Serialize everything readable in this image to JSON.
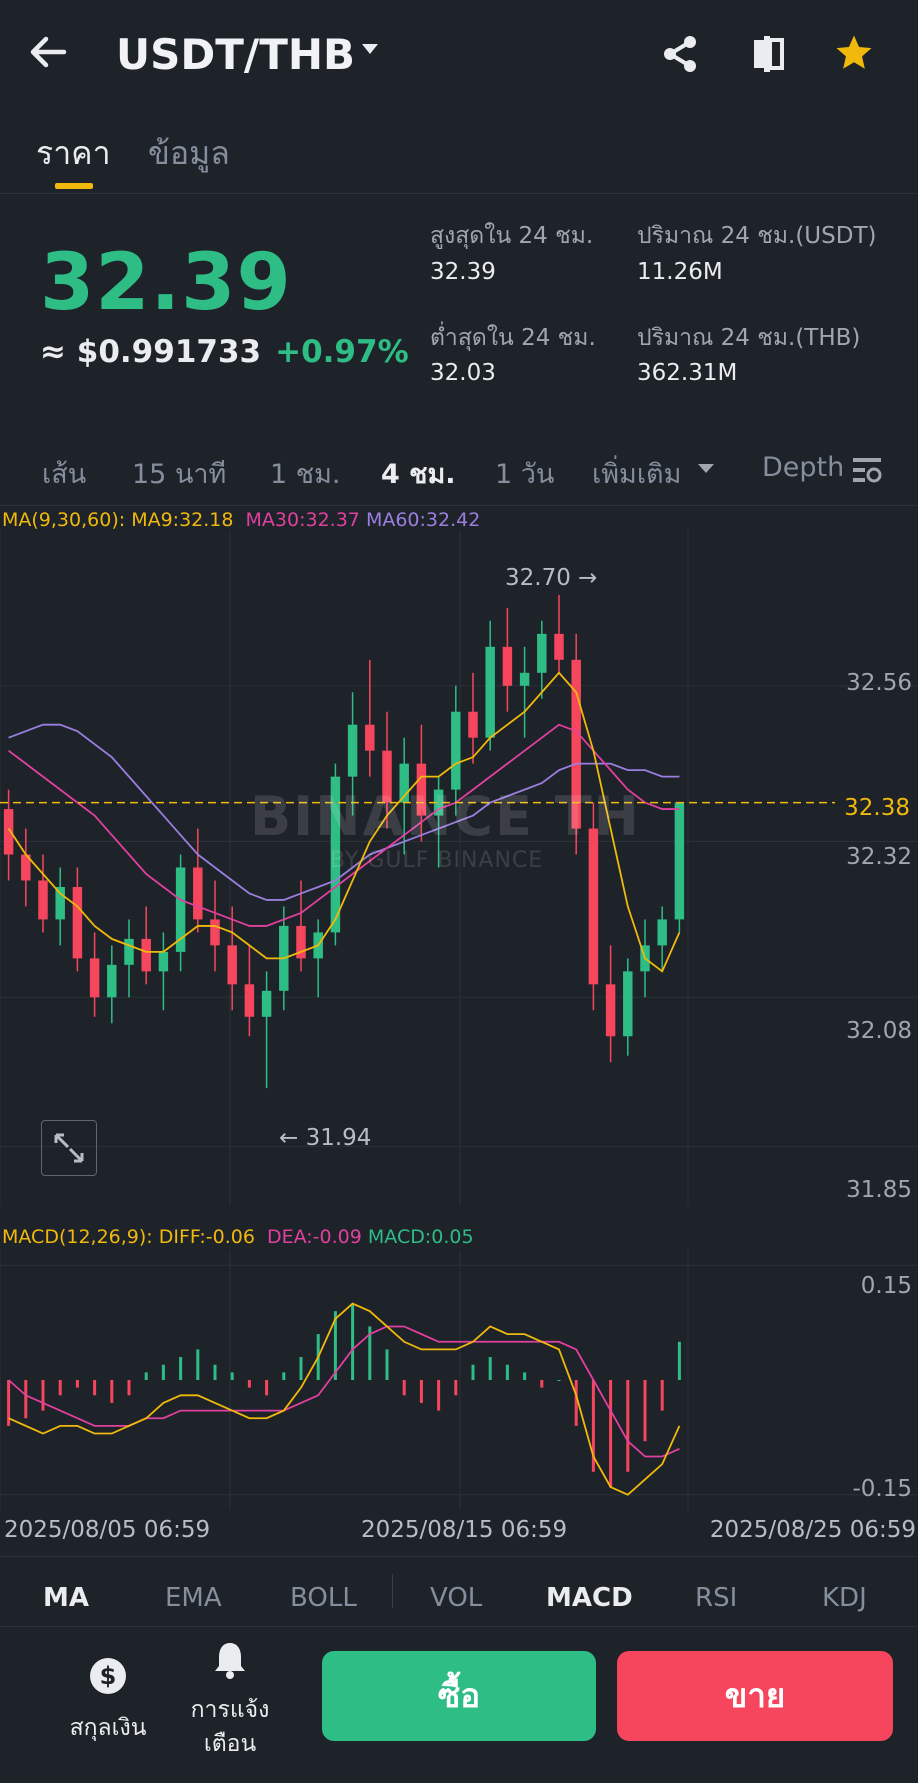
{
  "header": {
    "title": "USDT/THB",
    "icons": [
      "back-arrow-icon",
      "chevron-down-icon",
      "share-icon",
      "compare-icon",
      "star-icon"
    ]
  },
  "tabs": [
    {
      "label": "ราคา"
    },
    {
      "label": "ข้อมูล"
    }
  ],
  "ticker": {
    "price": "32.39",
    "usd": "≈ $0.991733",
    "change": "+0.97%",
    "high_label": "สูงสุดใน 24 ชม.",
    "high_value": "32.39",
    "low_label": "ต่ำสุดใน 24 ชม.",
    "low_value": "32.03",
    "vol_usdt_label": "ปริมาณ 24 ชม.(USDT)",
    "vol_usdt_value": "11.26M",
    "vol_thb_label": "ปริมาณ 24 ชม.(THB)",
    "vol_thb_value": "362.31M"
  },
  "intervals": [
    {
      "label": "เส้น"
    },
    {
      "label": "15 นาที"
    },
    {
      "label": "1 ชม."
    },
    {
      "label": "4 ชม.",
      "active": true
    },
    {
      "label": "1 วัน"
    },
    {
      "label": "เพิ่มเติม"
    },
    {
      "label": "Depth"
    }
  ],
  "ma_legend": {
    "params": "MA(9,30,60):",
    "ma9": "MA9:32.18",
    "ma30": "MA30:32.37",
    "ma60": "MA60:32.42"
  },
  "macd_legend": {
    "params": "MACD(12,26,9):",
    "diff": "DIFF:-0.06",
    "dea": "DEA:-0.09",
    "macd": "MACD:0.05"
  },
  "watermark": {
    "brand": "BINANCE TH",
    "sub": "BY GULF BINANCE"
  },
  "colors": {
    "up": "#2ebd85",
    "down": "#f6465d",
    "accent": "#f0b90b",
    "ma9": "#f0b90b",
    "ma30": "#e040a0",
    "ma60": "#9b7fe0"
  },
  "chart_data": {
    "type": "candlestick",
    "price_axis": [
      "32.56",
      "32.32",
      "32.08",
      "31.85"
    ],
    "current_price_tag": "32.38",
    "high_marker": "32.70 →",
    "low_marker": "← 31.94",
    "macd_axis": [
      "0.15",
      "-0.15"
    ],
    "x_labels": [
      "2025/08/05 06:59",
      "2025/08/15 06:59",
      "2025/08/25 06:59"
    ],
    "candles": [
      [
        32.37,
        32.4,
        32.26,
        32.3
      ],
      [
        32.3,
        32.34,
        32.22,
        32.26
      ],
      [
        32.26,
        32.3,
        32.18,
        32.2
      ],
      [
        32.2,
        32.28,
        32.16,
        32.25
      ],
      [
        32.25,
        32.28,
        32.12,
        32.14
      ],
      [
        32.14,
        32.18,
        32.05,
        32.08
      ],
      [
        32.08,
        32.16,
        32.04,
        32.13
      ],
      [
        32.13,
        32.2,
        32.08,
        32.17
      ],
      [
        32.17,
        32.22,
        32.1,
        32.12
      ],
      [
        32.12,
        32.18,
        32.06,
        32.15
      ],
      [
        32.15,
        32.3,
        32.12,
        32.28
      ],
      [
        32.28,
        32.34,
        32.18,
        32.2
      ],
      [
        32.2,
        32.26,
        32.12,
        32.16
      ],
      [
        32.16,
        32.22,
        32.06,
        32.1
      ],
      [
        32.1,
        32.16,
        32.02,
        32.05
      ],
      [
        32.05,
        32.12,
        31.94,
        32.09
      ],
      [
        32.09,
        32.22,
        32.06,
        32.19
      ],
      [
        32.19,
        32.26,
        32.12,
        32.14
      ],
      [
        32.14,
        32.2,
        32.08,
        32.18
      ],
      [
        32.18,
        32.44,
        32.16,
        32.42
      ],
      [
        32.42,
        32.55,
        32.36,
        32.5
      ],
      [
        32.5,
        32.6,
        32.42,
        32.46
      ],
      [
        32.46,
        32.52,
        32.34,
        32.38
      ],
      [
        32.38,
        32.48,
        32.3,
        32.44
      ],
      [
        32.44,
        32.5,
        32.32,
        32.36
      ],
      [
        32.36,
        32.42,
        32.28,
        32.4
      ],
      [
        32.4,
        32.56,
        32.36,
        32.52
      ],
      [
        32.52,
        32.58,
        32.44,
        32.48
      ],
      [
        32.48,
        32.66,
        32.46,
        32.62
      ],
      [
        32.62,
        32.68,
        32.52,
        32.56
      ],
      [
        32.56,
        32.62,
        32.48,
        32.58
      ],
      [
        32.58,
        32.66,
        32.54,
        32.64
      ],
      [
        32.64,
        32.7,
        32.58,
        32.6
      ],
      [
        32.6,
        32.64,
        32.3,
        32.34
      ],
      [
        32.34,
        32.38,
        32.06,
        32.1
      ],
      [
        32.1,
        32.16,
        31.98,
        32.02
      ],
      [
        32.02,
        32.14,
        31.99,
        32.12
      ],
      [
        32.12,
        32.2,
        32.08,
        32.16
      ],
      [
        32.16,
        32.22,
        32.12,
        32.2
      ],
      [
        32.2,
        32.38,
        32.18,
        32.38
      ]
    ],
    "ma9": [
      32.34,
      32.3,
      32.27,
      32.24,
      32.22,
      32.19,
      32.17,
      32.16,
      32.15,
      32.15,
      32.17,
      32.19,
      32.19,
      32.18,
      32.16,
      32.14,
      32.14,
      32.15,
      32.16,
      32.2,
      32.26,
      32.32,
      32.36,
      32.39,
      32.42,
      32.42,
      32.44,
      32.45,
      32.48,
      32.5,
      32.52,
      32.55,
      32.58,
      32.55,
      32.46,
      32.34,
      32.22,
      32.14,
      32.12,
      32.18
    ],
    "ma30": [
      32.46,
      32.44,
      32.42,
      32.4,
      32.38,
      32.36,
      32.33,
      32.3,
      32.27,
      32.25,
      32.23,
      32.22,
      32.21,
      32.2,
      32.19,
      32.19,
      32.2,
      32.21,
      32.23,
      32.25,
      32.27,
      32.29,
      32.31,
      32.33,
      32.35,
      32.37,
      32.38,
      32.4,
      32.42,
      32.44,
      32.46,
      32.48,
      32.5,
      32.49,
      32.46,
      32.43,
      32.4,
      32.38,
      32.37,
      32.37
    ],
    "ma60": [
      32.48,
      32.49,
      32.5,
      32.5,
      32.49,
      32.47,
      32.45,
      32.42,
      32.39,
      32.36,
      32.33,
      32.3,
      32.28,
      32.26,
      32.24,
      32.23,
      32.23,
      32.24,
      32.25,
      32.26,
      32.28,
      32.3,
      32.31,
      32.32,
      32.33,
      32.34,
      32.35,
      32.36,
      32.38,
      32.39,
      32.4,
      32.41,
      32.43,
      32.44,
      32.44,
      32.44,
      32.43,
      32.43,
      32.42,
      32.42
    ],
    "macd_hist": [
      -0.06,
      -0.05,
      -0.04,
      -0.02,
      -0.01,
      -0.02,
      -0.03,
      -0.02,
      0.01,
      0.02,
      0.03,
      0.04,
      0.02,
      0.01,
      -0.01,
      -0.02,
      0.01,
      0.03,
      0.06,
      0.09,
      0.1,
      0.07,
      0.04,
      -0.02,
      -0.03,
      -0.04,
      -0.02,
      0.02,
      0.03,
      0.02,
      0.01,
      -0.01,
      0.0,
      -0.06,
      -0.12,
      -0.14,
      -0.12,
      -0.08,
      -0.04,
      0.05
    ],
    "macd_diff": [
      -0.05,
      -0.06,
      -0.07,
      -0.06,
      -0.06,
      -0.07,
      -0.07,
      -0.06,
      -0.05,
      -0.03,
      -0.02,
      -0.02,
      -0.03,
      -0.04,
      -0.05,
      -0.05,
      -0.04,
      -0.01,
      0.03,
      0.08,
      0.1,
      0.09,
      0.07,
      0.05,
      0.04,
      0.04,
      0.04,
      0.05,
      0.07,
      0.06,
      0.06,
      0.05,
      0.04,
      -0.02,
      -0.1,
      -0.14,
      -0.15,
      -0.13,
      -0.11,
      -0.06
    ],
    "macd_dea": [
      0.0,
      -0.02,
      -0.03,
      -0.04,
      -0.05,
      -0.06,
      -0.06,
      -0.06,
      -0.05,
      -0.05,
      -0.04,
      -0.04,
      -0.04,
      -0.04,
      -0.04,
      -0.04,
      -0.04,
      -0.03,
      -0.02,
      0.01,
      0.04,
      0.06,
      0.07,
      0.07,
      0.06,
      0.05,
      0.05,
      0.05,
      0.05,
      0.05,
      0.05,
      0.05,
      0.05,
      0.04,
      0.0,
      -0.04,
      -0.08,
      -0.1,
      -0.1,
      -0.09
    ]
  },
  "bottom_tabs": [
    {
      "label": "MA",
      "active": true
    },
    {
      "label": "EMA"
    },
    {
      "label": "BOLL"
    },
    {
      "label": "VOL"
    },
    {
      "label": "MACD",
      "active": true
    },
    {
      "label": "RSI"
    },
    {
      "label": "KDJ"
    }
  ],
  "footer": {
    "currency_label": "สกุลเงิน",
    "alert_label_1": "การแจ้ง",
    "alert_label_2": "เตือน",
    "buy": "ซื้อ",
    "sell": "ขาย"
  }
}
